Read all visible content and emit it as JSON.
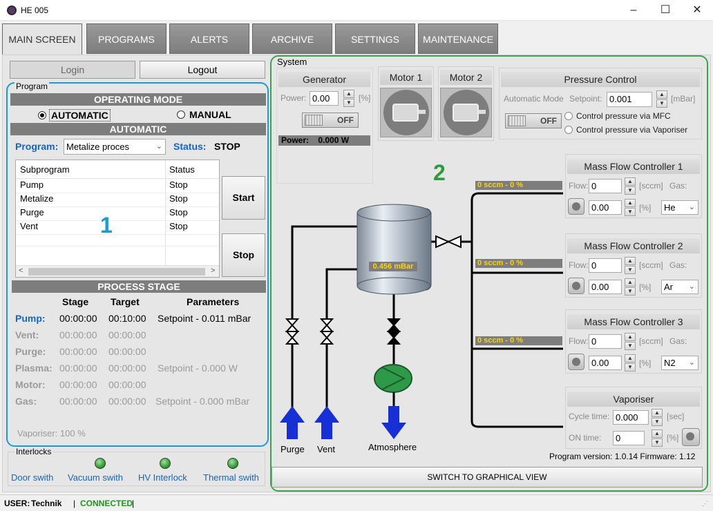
{
  "window": {
    "title": "HE 005",
    "minimize": "–",
    "maximize": "☐",
    "close": "✕"
  },
  "tabs": [
    "MAIN SCREEN",
    "PROGRAMS",
    "ALERTS",
    "ARCHIVE",
    "SETTINGS",
    "MAINTENANCE"
  ],
  "auth": {
    "login": "Login",
    "logout": "Logout"
  },
  "program": {
    "group_label": "Program",
    "operating_mode_header": "OPERATING MODE",
    "mode_automatic": "AUTOMATIC",
    "mode_manual": "MANUAL",
    "automatic_header": "AUTOMATIC",
    "program_label": "Program:",
    "program_value": "Metalize proces",
    "status_label": "Status:",
    "status_value": "STOP",
    "table_headers": [
      "Subprogram",
      "Status"
    ],
    "rows": [
      [
        "Pump",
        "Stop"
      ],
      [
        "Metalize",
        "Stop"
      ],
      [
        "Purge",
        "Stop"
      ],
      [
        "Vent",
        "Stop"
      ]
    ],
    "start": "Start",
    "stop": "Stop",
    "annotation": "1"
  },
  "stage": {
    "header": "PROCESS STAGE",
    "columns": [
      "Stage",
      "Target",
      "Parameters"
    ],
    "rows": [
      {
        "name": "Pump:",
        "stage": "00:00:00",
        "target": "00:10:00",
        "params": "Setpoint - 0.011 mBar"
      },
      {
        "name": "Vent:",
        "stage": "00:00:00",
        "target": "00:00:00",
        "params": ""
      },
      {
        "name": "Purge:",
        "stage": "00:00:00",
        "target": "00:00:00",
        "params": ""
      },
      {
        "name": "Plasma:",
        "stage": "00:00:00",
        "target": "00:00:00",
        "params": "Setpoint - 0.000 W"
      },
      {
        "name": "Motor:",
        "stage": "00:00:00",
        "target": "00:00:00",
        "params": ""
      },
      {
        "name": "Gas:",
        "stage": "00:00:00",
        "target": "00:00:00",
        "params": "Setpoint - 0.000 mBar"
      }
    ],
    "vaporiser": "Vaporiser: 100 %"
  },
  "interlocks": {
    "label": "Interlocks",
    "items": [
      "Door swith",
      "Vacuum swith",
      "HV Interlock",
      "Thermal swith"
    ]
  },
  "system": {
    "label": "System",
    "annotation": "2",
    "generator": {
      "title": "Generator",
      "power_label": "Power:",
      "power_value": "0.00",
      "unit": "[%]",
      "toggle": "OFF",
      "readout": "Power:    0.000 W"
    },
    "motor1": "Motor 1",
    "motor2": "Motor 2",
    "pressure": {
      "title": "Pressure Control",
      "mode": "Automatic Mode",
      "setpoint_label": "Setpoint:",
      "setpoint_value": "0.001",
      "unit": "[mBar]",
      "toggle": "OFF",
      "opt1": "Control pressure via MFC",
      "opt2": "Control pressure via Vaporiser"
    },
    "chamber_pressure": "0.456 mBar",
    "mfc": [
      {
        "title": "Mass Flow Controller 1",
        "flow_label": "Flow:",
        "flow_value": "0",
        "unit": "[sccm]",
        "gas_label": "Gas:",
        "gas": "He",
        "pct": "0.00",
        "pct_unit": "[%]",
        "readout": "0 sccm - 0 %"
      },
      {
        "title": "Mass Flow Controller 2",
        "flow_label": "Flow:",
        "flow_value": "0",
        "unit": "[sccm]",
        "gas_label": "Gas:",
        "gas": "Ar",
        "pct": "0.00",
        "pct_unit": "[%]",
        "readout": "0 sccm - 0 %"
      },
      {
        "title": "Mass Flow Controller 3",
        "flow_label": "Flow:",
        "flow_value": "0",
        "unit": "[sccm]",
        "gas_label": "Gas:",
        "gas": "N2",
        "pct": "0.00",
        "pct_unit": "[%]",
        "readout": "0 sccm - 0 %"
      }
    ],
    "vaporiser": {
      "title": "Vaporiser",
      "cycle_label": "Cycle time:",
      "cycle_value": "0.000",
      "cycle_unit": "[sec]",
      "on_label": "ON time:",
      "on_value": "0",
      "on_unit": "[%]"
    },
    "labels": {
      "purge": "Purge",
      "vent": "Vent",
      "atmosphere": "Atmosphere"
    },
    "version": "Program version: 1.0.14 Firmware: 1.12",
    "switch_view": "SWITCH TO GRAPHICAL VIEW"
  },
  "statusbar": {
    "user_label": "USER:",
    "user": "Technik",
    "connected": "CONNECTED",
    "sep": "|"
  },
  "colors": {
    "blue_outline": "#1a9ad6",
    "green_outline": "#3aa64a",
    "annotation_blue": "#1a9ad6",
    "annotation_green": "#2e9a3a",
    "accent": "#1565c0"
  }
}
